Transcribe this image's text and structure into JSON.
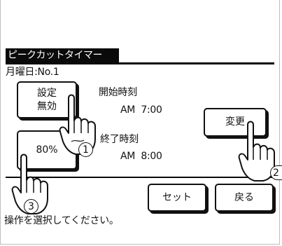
{
  "title": "ピークカットタイマー",
  "subheader": "月曜日:No.1",
  "setting_button": {
    "line1": "設定",
    "line2": "無効"
  },
  "percent_button": "80%",
  "start": {
    "label": "開始時刻",
    "time": "AM  7:00"
  },
  "end": {
    "label": "終了時刻",
    "time": "AM  8:00"
  },
  "change_button": "変更",
  "set_button": "セット",
  "back_button": "戻る",
  "message": "操作を選択してください。",
  "callouts": [
    "1",
    "2",
    "3"
  ],
  "icons": {
    "hand": "pointing-hand-icon"
  }
}
